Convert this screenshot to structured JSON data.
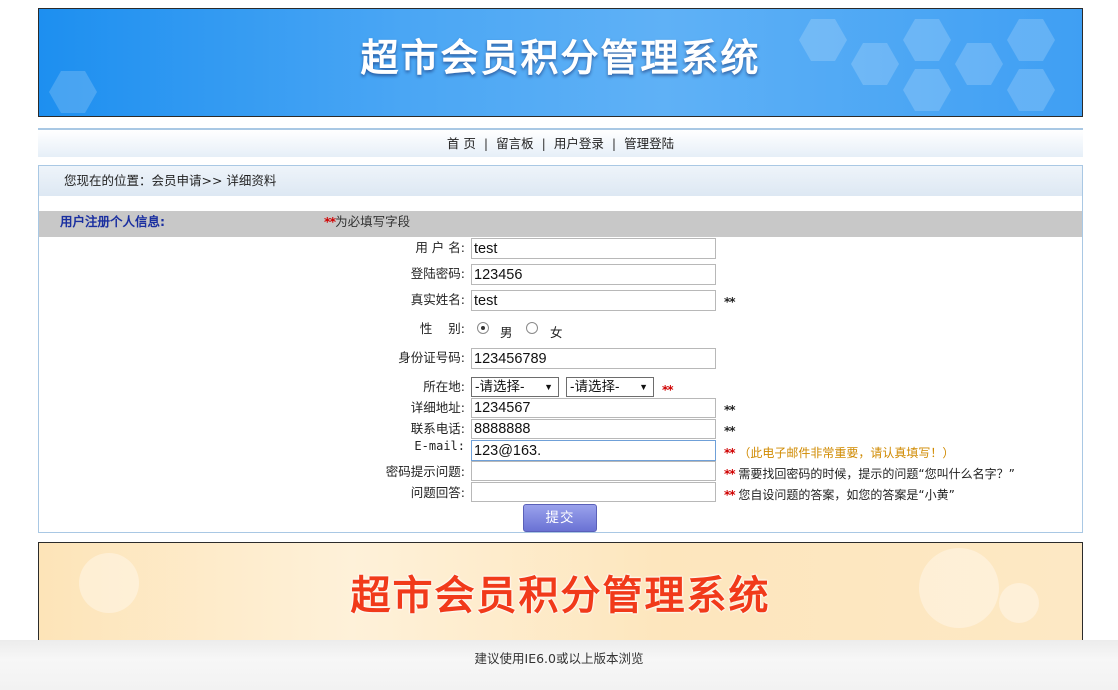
{
  "banner": {
    "title": "超市会员积分管理系统"
  },
  "nav": {
    "items": [
      "首 页",
      "留言板",
      "用户登录",
      "管理登陆"
    ],
    "separator": "|"
  },
  "location": {
    "text": "您现在的位置：会员申请>> 详细资料"
  },
  "section": {
    "title": "用户注册个人信息:",
    "required_mark": "**",
    "required_note": "为必填写字段"
  },
  "form": {
    "username": {
      "label": "用 户 名:",
      "value": "test"
    },
    "password": {
      "label": "登陆密码:",
      "value": "123456"
    },
    "realname": {
      "label": "真实姓名:",
      "value": "test",
      "mark": "**"
    },
    "gender": {
      "label": "性    别:",
      "male": "男",
      "female": "女",
      "selected": "男"
    },
    "idcard": {
      "label": "身份证号码:",
      "value": "123456789"
    },
    "region": {
      "label": "所在地:",
      "select1": "-请选择-",
      "select2": "-请选择-",
      "mark": "**"
    },
    "address": {
      "label": "详细地址:",
      "value": "1234567",
      "mark": "**"
    },
    "phone": {
      "label": "联系电话:",
      "value": "8888888",
      "mark": "**"
    },
    "email": {
      "label": "E-mail:",
      "value": "123@163.",
      "mark": "**",
      "note": "（此电子邮件非常重要，请认真填写！）"
    },
    "question": {
      "label": "密码提示问题:",
      "value": "",
      "mark": "**",
      "note": "需要找回密码的时候，提示的问题“您叫什么名字？”"
    },
    "answer": {
      "label": "问题回答:",
      "value": "",
      "mark": "**",
      "note": "您自设问题的答案，如您的答案是“小黄”"
    },
    "submit_label": "提交"
  },
  "footer_banner": {
    "title": "超市会员积分管理系统"
  },
  "bottom": {
    "text": "建议使用IE6.0或以上版本浏览"
  },
  "colors": {
    "banner_blue": "#3f9ff3",
    "required_red": "#d00000",
    "note_orange": "#d08a00",
    "section_blue": "#1a2fa0",
    "footer_title_red": "#f13a1a"
  }
}
